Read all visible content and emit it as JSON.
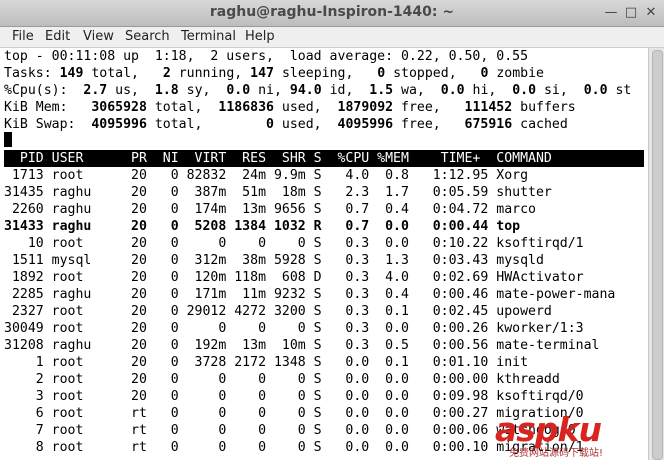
{
  "window": {
    "title": "raghu@raghu-Inspiron-1440: ~",
    "minimize_glyph": "—",
    "maximize_glyph": "□",
    "close_glyph": "✕"
  },
  "menu": [
    "File",
    "Edit",
    "View",
    "Search",
    "Terminal",
    "Help"
  ],
  "summary": {
    "line1": "top - 00:11:08 up  1:18,  2 users,  load average: 0.22, 0.50, 0.55",
    "tasks": {
      "label": "Tasks: ",
      "total": "149",
      "total_label": " total,   ",
      "running": "2",
      "running_label": " running, ",
      "sleeping": "147",
      "sleeping_label": " sleeping,   ",
      "stopped": "0",
      "stopped_label": " stopped,   ",
      "zombie": "0",
      "zombie_label": " zombie"
    },
    "cpu": {
      "label": "%Cpu(s):  ",
      "us": "2.7",
      "us_label": " us,  ",
      "sy": "1.8",
      "sy_label": " sy,  ",
      "ni": "0.0",
      "ni_label": " ni, ",
      "id": "94.0",
      "id_label": " id,  ",
      "wa": "1.5",
      "wa_label": " wa,  ",
      "hi": "0.0",
      "hi_label": " hi,  ",
      "si": "0.0",
      "si_label": " si,  ",
      "st": "0.0",
      "st_label": " st"
    },
    "mem": {
      "label": "KiB Mem:   ",
      "total": "3065928",
      "total_label": " total,  ",
      "used": "1186836",
      "used_label": " used,  ",
      "free": "1879092",
      "free_label": " free,   ",
      "buffers": "111452",
      "buffers_label": " buffers"
    },
    "swap": {
      "label": "KiB Swap:  ",
      "total": "4095996",
      "total_label": " total,        ",
      "used": "0",
      "used_label": " used,  ",
      "free": "4095996",
      "free_label": " free,   ",
      "cached": "675916",
      "cached_label": " cached"
    }
  },
  "header": "  PID USER      PR  NI  VIRT  RES  SHR S  %CPU %MEM    TIME+  COMMAND",
  "rows": [
    {
      "text": " 1713 root      20   0 82832  24m 9.9m S   4.0  0.8   1:12.95 Xorg",
      "bold": false
    },
    {
      "text": "31435 raghu     20   0  387m  51m  18m S   2.3  1.7   0:05.59 shutter",
      "bold": false
    },
    {
      "text": " 2260 raghu     20   0  174m  13m 9656 S   0.7  0.4   0:04.72 marco",
      "bold": false
    },
    {
      "text": "31433 raghu     20   0  5208 1384 1032 R   0.7  0.0   0:00.44 top",
      "bold": true
    },
    {
      "text": "   10 root      20   0     0    0    0 S   0.3  0.0   0:10.22 ksoftirqd/1",
      "bold": false
    },
    {
      "text": " 1511 mysql     20   0  312m  38m 5928 S   0.3  1.3   0:03.43 mysqld",
      "bold": false
    },
    {
      "text": " 1892 root      20   0  120m 118m  608 D   0.3  4.0   0:02.69 HWActivator",
      "bold": false
    },
    {
      "text": " 2285 raghu     20   0  171m  11m 9232 S   0.3  0.4   0:00.46 mate-power-mana",
      "bold": false
    },
    {
      "text": " 2327 root      20   0 29012 4272 3200 S   0.3  0.1   0:02.45 upowerd",
      "bold": false
    },
    {
      "text": "30049 root      20   0     0    0    0 S   0.3  0.0   0:00.26 kworker/1:3",
      "bold": false
    },
    {
      "text": "31208 raghu     20   0  192m  13m  10m S   0.3  0.5   0:00.56 mate-terminal",
      "bold": false
    },
    {
      "text": "    1 root      20   0  3728 2172 1348 S   0.0  0.1   0:01.10 init",
      "bold": false
    },
    {
      "text": "    2 root      20   0     0    0    0 S   0.0  0.0   0:00.00 kthreadd",
      "bold": false
    },
    {
      "text": "    3 root      20   0     0    0    0 S   0.0  0.0   0:09.98 ksoftirqd/0",
      "bold": false
    },
    {
      "text": "    6 root      rt   0     0    0    0 S   0.0  0.0   0:00.27 migration/0",
      "bold": false
    },
    {
      "text": "    7 root      rt   0     0    0    0 S   0.0  0.0   0:00.06 watchdog/0",
      "bold": false
    },
    {
      "text": "    8 root      rt   0     0    0    0 S   0.0  0.0   0:00.10 migration/1",
      "bold": false
    }
  ],
  "watermark": {
    "logo": "aspku",
    "sub": "免费网站源码下载站!",
    "color": "#d8251f"
  }
}
